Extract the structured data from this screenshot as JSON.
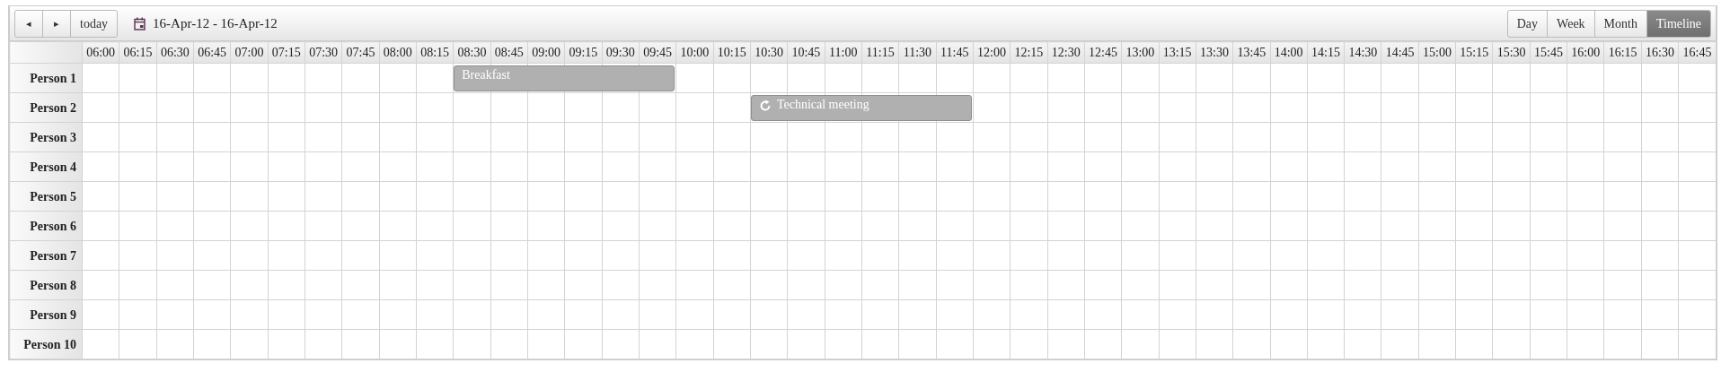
{
  "toolbar": {
    "nav_buttons": [
      "◂",
      "▸"
    ],
    "today_button": "today",
    "date_range": "16-Apr-12 - 16-Apr-12",
    "views": [
      {
        "label": "Day",
        "selected": false
      },
      {
        "label": "Week",
        "selected": false
      },
      {
        "label": "Month",
        "selected": false
      },
      {
        "label": "Timeline",
        "selected": true
      }
    ]
  },
  "timeline": {
    "columns": [
      "06:00",
      "06:15",
      "06:30",
      "06:45",
      "07:00",
      "07:15",
      "07:30",
      "07:45",
      "08:00",
      "08:15",
      "08:30",
      "08:45",
      "09:00",
      "09:15",
      "09:30",
      "09:45",
      "10:00",
      "10:15",
      "10:30",
      "10:45",
      "11:00",
      "11:15",
      "11:30",
      "11:45",
      "12:00",
      "12:15",
      "12:30",
      "12:45",
      "13:00",
      "13:15",
      "13:30",
      "13:45",
      "14:00",
      "14:15",
      "14:30",
      "14:45",
      "15:00",
      "15:15",
      "15:30",
      "15:45",
      "16:00",
      "16:15",
      "16:30",
      "16:45"
    ],
    "rows": [
      {
        "resource": "Person 1",
        "events": [
          {
            "title": "Breakfast",
            "recurring": false,
            "covers": [
              false,
              false,
              false,
              false,
              false,
              false,
              false,
              false,
              false,
              false,
              true,
              true,
              true,
              true,
              true,
              true,
              false,
              false,
              false,
              false,
              false,
              false,
              false,
              false,
              false,
              false,
              false,
              false,
              false,
              false,
              false,
              false,
              false,
              false,
              false,
              false,
              false,
              false,
              false,
              false,
              false,
              false,
              false,
              false
            ]
          }
        ]
      },
      {
        "resource": "Person 2",
        "events": [
          {
            "title": "Technical meeting",
            "recurring": true,
            "covers": [
              false,
              false,
              false,
              false,
              false,
              false,
              false,
              false,
              false,
              false,
              false,
              false,
              false,
              false,
              false,
              false,
              false,
              false,
              true,
              true,
              true,
              true,
              true,
              true,
              false,
              false,
              false,
              false,
              false,
              false,
              false,
              false,
              false,
              false,
              false,
              false,
              false,
              false,
              false,
              false,
              false,
              false,
              false,
              false
            ]
          }
        ]
      },
      {
        "resource": "Person 3"
      },
      {
        "resource": "Person 4"
      },
      {
        "resource": "Person 5"
      },
      {
        "resource": "Person 6"
      },
      {
        "resource": "Person 7"
      },
      {
        "resource": "Person 8"
      },
      {
        "resource": "Person 9"
      },
      {
        "resource": "Person 10"
      }
    ]
  }
}
